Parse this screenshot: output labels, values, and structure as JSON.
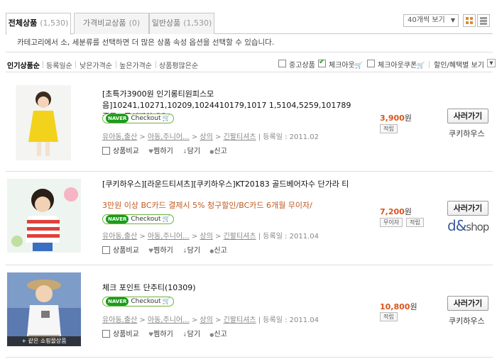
{
  "tabs": [
    {
      "label": "전체상품",
      "count": "(1,530)"
    },
    {
      "label": "가격비교상품",
      "count": "(0)"
    },
    {
      "label": "일반상품",
      "count": "(1,530)"
    }
  ],
  "view_select": {
    "value": "40개씩 보기",
    "arrow": "▼"
  },
  "notice": "카테고리에서 소, 세분류를 선택하면 더 많은 상품 속성 옵션을 선택할 수 있습니다.",
  "sort": [
    "인기상품순",
    "등록일순",
    "낮은가격순",
    "높은가격순",
    "상품평많은순"
  ],
  "filters": {
    "used": "중고상품",
    "checkout": "체크아웃",
    "checkout_coupon": "체크아웃쿠폰",
    "discount_view": "할인/혜택별 보기",
    "cart_glyph": "🛒",
    "dropdown": "▼"
  },
  "common": {
    "naver": "NAVER",
    "checkout_label": "Checkout",
    "cart_glyph": "🛒",
    "compare": "상품비교",
    "wish": "찜하기",
    "keep": "담기",
    "report": "신고",
    "buy": "사러가기",
    "wish_glyph": "♥",
    "keep_glyph": "↓",
    "report_glyph": "●"
  },
  "items": [
    {
      "title": "[초특가3900원 인기롱티원피스모음]10241,10271,10209,1024410179,1017 1,5104,5259,101789종중 1종선택하세요",
      "promo": "",
      "cat1": "유아동,출산",
      "cat2": "아동,주니어...",
      "cat3": "상의",
      "cat4": "긴팔티셔츠",
      "reg": "등록일 : 2011.02",
      "price": "3,900",
      "won": "원",
      "badges": [
        "적립"
      ],
      "mall": "쿠키하우스"
    },
    {
      "title": "[쿠키하우스][라운드티셔츠][쿠키하우스]KT20183 골드베어자수 단가라 티",
      "promo": "3만원 이상 BC카드 결제시 5% 청구할인/BC카드 6개월 무이자/",
      "cat1": "유아동,출산",
      "cat2": "아동,주니어...",
      "cat3": "상의",
      "cat4": "긴팔티셔츠",
      "reg": "등록일 : 2011.04",
      "price": "7,200",
      "won": "원",
      "badges": [
        "무이자",
        "적립"
      ],
      "mall_logo_a": "d&",
      "mall_logo_b": "shop"
    },
    {
      "title": "체크 포인트 단추티(10309)",
      "promo": "",
      "cat1": "유아동,출산",
      "cat2": "아동,주니어...",
      "cat3": "상의",
      "cat4": "긴팔티셔츠",
      "reg": "등록일 : 2011.04",
      "price": "10,800",
      "won": "원",
      "badges": [
        "적립"
      ],
      "mall": "쿠키하우스",
      "same_mall": "+ 같은 쇼핑몰상품"
    }
  ]
}
